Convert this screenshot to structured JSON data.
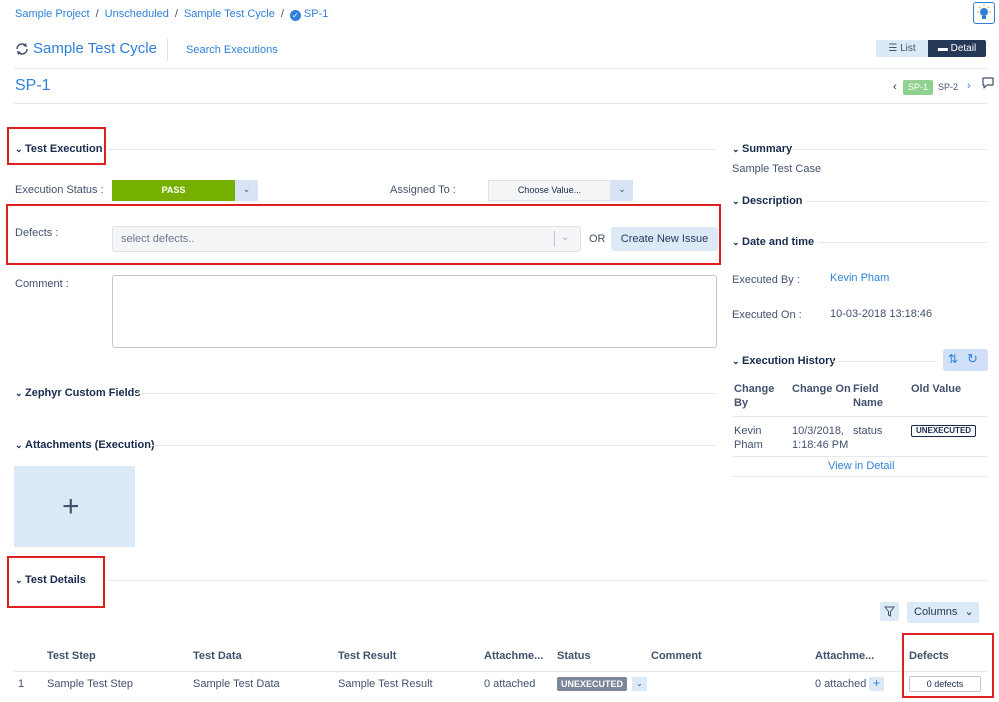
{
  "breadcrumb": {
    "items": [
      "Sample Project",
      "Unscheduled",
      "Sample Test Cycle"
    ],
    "current": "SP-1",
    "separator": "/"
  },
  "header": {
    "cycle_title": "Sample Test Cycle",
    "search_link": "Search Executions",
    "view_list": "List",
    "view_detail": "Detail"
  },
  "execution_nav": {
    "title": "SP-1",
    "current": "SP-1",
    "next": "SP-2"
  },
  "test_execution": {
    "heading": "Test Execution",
    "status_label": "Execution Status :",
    "status_value": "PASS",
    "status_color": "#75b000",
    "assigned_label": "Assigned To :",
    "assigned_value": "Choose Value...",
    "defects_label": "Defects :",
    "defects_placeholder": "select defects..",
    "or_label": "OR",
    "create_issue": "Create New Issue",
    "comment_label": "Comment :"
  },
  "custom_fields": {
    "heading": "Zephyr Custom Fields"
  },
  "attachments": {
    "heading": "Attachments (Execution)"
  },
  "test_details": {
    "heading": "Test Details",
    "columns_button": "Columns",
    "headers": [
      "Test Step",
      "Test Data",
      "Test Result",
      "Attachme...",
      "Status",
      "Comment",
      "Attachme...",
      "Defects"
    ],
    "row": {
      "index": "1",
      "step": "Sample Test Step",
      "data": "Sample Test Data",
      "result": "Sample Test Result",
      "attach1": "0 attached",
      "status": "UNEXECUTED",
      "attach2": "0 attached",
      "defects": "0 defects"
    }
  },
  "summary": {
    "heading": "Summary",
    "value": "Sample Test Case"
  },
  "description": {
    "heading": "Description"
  },
  "date_time": {
    "heading": "Date and time",
    "executed_by_label": "Executed By :",
    "executed_by": "Kevin Pham",
    "executed_on_label": "Executed On :",
    "executed_on": "10-03-2018 13:18:46"
  },
  "history": {
    "heading": "Execution History",
    "headers": {
      "change_by_1": "Change",
      "change_by_2": "By",
      "change_on": "Change On",
      "field_name_1": "Field",
      "field_name_2": "Name",
      "old_value": "Old Value"
    },
    "row": {
      "by_1": "Kevin",
      "by_2": "Pham",
      "on_1": "10/3/2018,",
      "on_2": "1:18:46 PM",
      "field": "status",
      "old_value": "UNEXECUTED"
    },
    "view_detail": "View in Detail"
  },
  "colors": {
    "link": "#2f80d9",
    "highlight": "#e02020",
    "unexecuted": "#7a869a"
  },
  "icons": [
    "lightbulb-icon",
    "cycle-icon",
    "check-circle-icon",
    "list-icon",
    "detail-icon",
    "chat-icon",
    "sort-icon",
    "refresh-icon",
    "filter-icon",
    "plus-icon",
    "chevron-down-icon"
  ]
}
